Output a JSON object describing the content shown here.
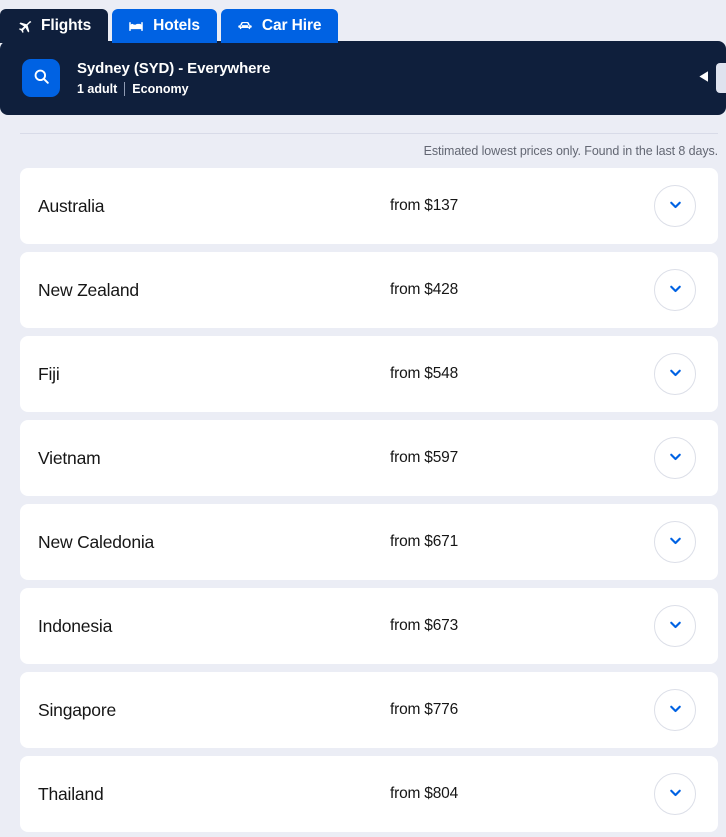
{
  "nav": {
    "tabs": [
      {
        "label": "Flights",
        "icon": "plane-icon",
        "active": true
      },
      {
        "label": "Hotels",
        "icon": "bed-icon",
        "active": false
      },
      {
        "label": "Car Hire",
        "icon": "car-icon",
        "active": false
      }
    ]
  },
  "search_bar": {
    "search_icon": "search-icon",
    "route": "Sydney (SYD) - Everywhere",
    "passengers": "1 adult",
    "cabin_class": "Economy",
    "prev_icon": "caret-left-icon",
    "next_icon": "caret-right-icon"
  },
  "notice": "Estimated lowest prices only. Found in the last 8 days.",
  "results": {
    "price_prefix": "from",
    "expand_icon": "chevron-down-icon",
    "items": [
      {
        "destination": "Australia",
        "price": "from $137"
      },
      {
        "destination": "New Zealand",
        "price": "from $428"
      },
      {
        "destination": "Fiji",
        "price": "from $548"
      },
      {
        "destination": "Vietnam",
        "price": "from $597"
      },
      {
        "destination": "New Caledonia",
        "price": "from $671"
      },
      {
        "destination": "Indonesia",
        "price": "from $673"
      },
      {
        "destination": "Singapore",
        "price": "from $776"
      },
      {
        "destination": "Thailand",
        "price": "from $804"
      }
    ]
  },
  "colors": {
    "brand_blue": "#0062e3",
    "dark_navy": "#0f1f3c",
    "page_background": "#ebedf5",
    "card_background": "#ffffff",
    "muted_text": "#636773"
  }
}
